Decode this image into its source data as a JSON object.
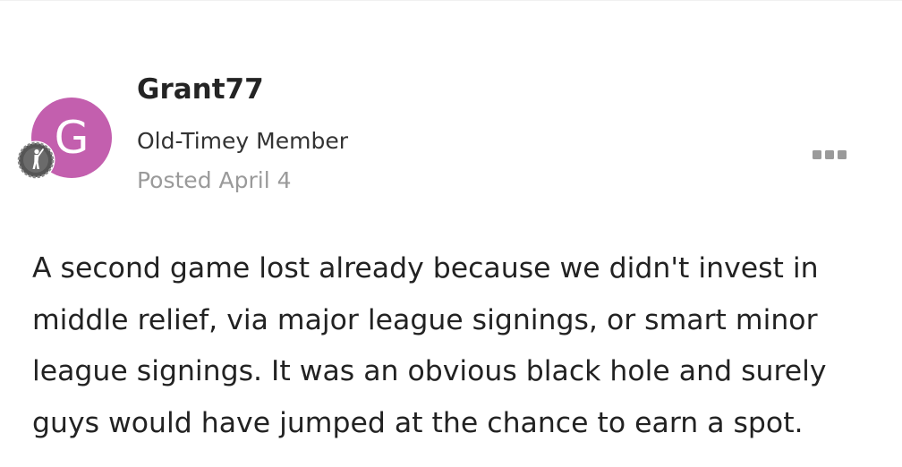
{
  "author": {
    "avatar_letter": "G",
    "avatar_color": "#c35fae",
    "username": "Grant77",
    "member_title": "Old-Timey Member",
    "rank_badge_icon": "rank-badge-icon"
  },
  "post": {
    "posted_label": "Posted April 4",
    "body": "A second game lost already because we didn't invest in middle relief, via major league signings, or smart minor league signings. It was an obvious black hole and surely guys would have jumped at the chance to earn a spot."
  },
  "menu": {
    "icon": "more-options-icon"
  }
}
